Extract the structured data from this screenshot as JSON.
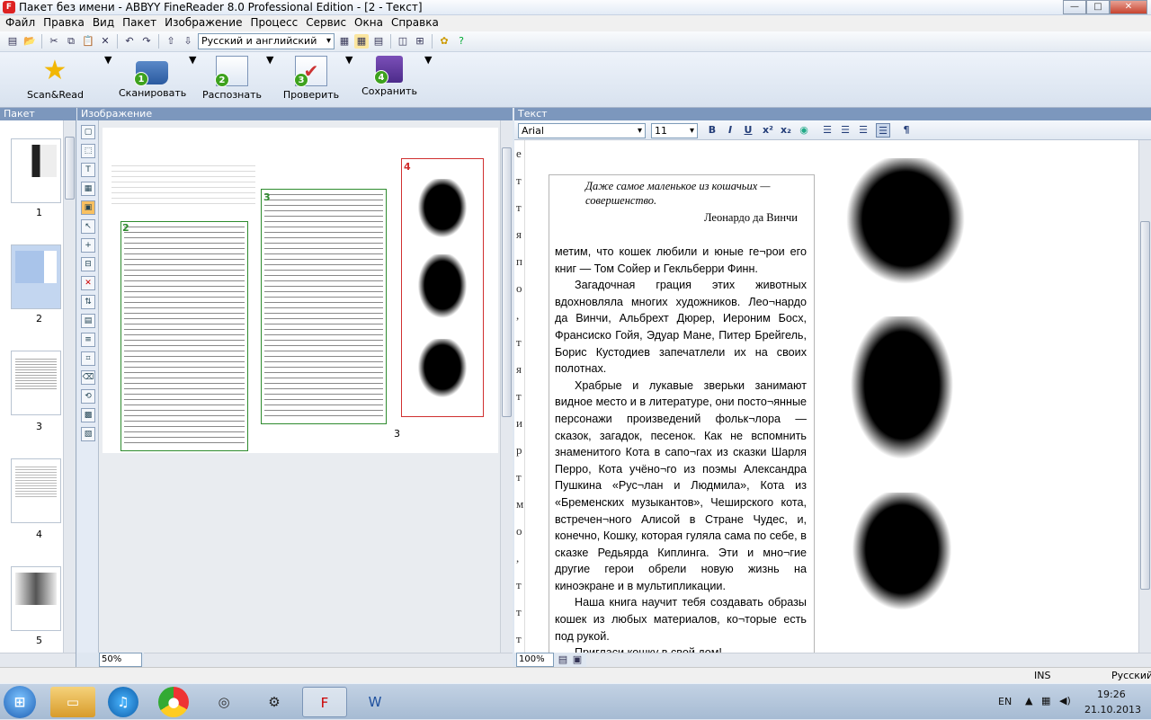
{
  "window": {
    "title": "Пакет без имени - ABBYY FineReader 8.0 Professional Edition - [2 - Текст]"
  },
  "menu": [
    "Файл",
    "Правка",
    "Вид",
    "Пакет",
    "Изображение",
    "Процесс",
    "Сервис",
    "Окна",
    "Справка"
  ],
  "toolbar": {
    "language": "Русский и английский"
  },
  "big_buttons": [
    {
      "label": "Scan&Read",
      "num": ""
    },
    {
      "label": "Сканировать",
      "num": "1"
    },
    {
      "label": "Распознать",
      "num": "2"
    },
    {
      "label": "Проверить",
      "num": "3"
    },
    {
      "label": "Сохранить",
      "num": "4"
    }
  ],
  "panels": {
    "packet": "Пакет",
    "image": "Изображение",
    "text": "Текст"
  },
  "thumbnails": [
    "1",
    "2",
    "3",
    "4",
    "5"
  ],
  "image_zoom": "50%",
  "text_zoom": "100%",
  "format": {
    "font": "Arial",
    "size": "11",
    "bold": "B",
    "italic": "I",
    "underline": "U",
    "sup": "x²",
    "sub": "x₂",
    "para": "¶"
  },
  "blocks": {
    "b2": "2",
    "b3": "3",
    "b4": "4",
    "page_no": "3"
  },
  "text": {
    "epigraph_a": "Даже самое маленькое из кошачьих —",
    "epigraph_b": "совершенство.",
    "author": "Леонардо да Винчи",
    "p1": "метим, что кошек любили и юные ге¬рои его книг — Том Сойер и Гекльберри Финн.",
    "p2": "Загадочная грация этих животных вдохновляла многих художников. Лео¬нардо да Винчи, Альбрехт Дюрер, Иероним Босх, Франсиско Гойя, Эдуар Мане, Питер Брейгель, Борис Кустодиев запечатлели их на своих полотнах.",
    "p3": "Храбрые и лукавые зверьки занимают видное место и в литературе, они посто¬янные персонажи произведений фольк¬лора — сказок, загадок, песенок. Как не вспомнить знаменитого Кота в сапо¬гах из сказки Шарля Перро, Кота учёно¬го из поэмы Александра Пушкина «Рус¬лан и Людмила», Кота из «Бременских музыкантов», Чеширского кота, встречен¬ного Алисой в Стране Чудес, и, конечно, Кошку, которая гуляла сама по себе, в сказке Редьярда Киплинга. Эти и мно¬гие другие герои обрели новую жизнь на киноэкране и в мультипликации.",
    "p4": "Наша книга научит тебя создавать образы кошек из любых материалов, ко¬торые есть под рукой.",
    "p5": "Пригласи кошку в свой дом!"
  },
  "status": {
    "ins": "INS",
    "lang": "Русский"
  },
  "tray": {
    "lang": "EN",
    "time": "19:26",
    "date": "21.10.2013"
  }
}
